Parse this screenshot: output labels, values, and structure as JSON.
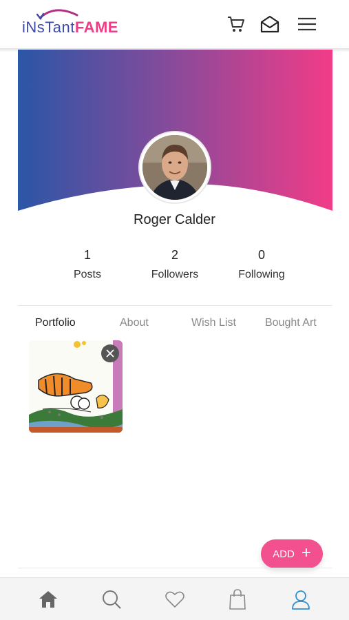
{
  "header": {
    "logo_part1": "iNsTant",
    "logo_part2": "FAME",
    "icons": [
      "cart-icon",
      "mail-open-icon",
      "menu-icon"
    ]
  },
  "colors": {
    "brand_blue": "#2f57a8",
    "brand_pink": "#f23c87",
    "accent_pink": "#f2508e",
    "active_nav": "#2f8fcf"
  },
  "profile": {
    "name": "Roger Calder"
  },
  "stats": [
    {
      "value": "1",
      "label": "Posts"
    },
    {
      "value": "2",
      "label": "Followers"
    },
    {
      "value": "0",
      "label": "Following"
    }
  ],
  "tabs": [
    {
      "label": "Portfolio",
      "active": true
    },
    {
      "label": "About",
      "active": false
    },
    {
      "label": "Wish List",
      "active": false
    },
    {
      "label": "Bought Art",
      "active": false
    }
  ],
  "add_button": {
    "label": "ADD"
  },
  "bottom_nav": [
    {
      "icon": "home-icon",
      "active": false
    },
    {
      "icon": "search-icon",
      "active": false
    },
    {
      "icon": "heart-icon",
      "active": false
    },
    {
      "icon": "shopping-bag-icon",
      "active": false
    },
    {
      "icon": "user-icon",
      "active": true
    }
  ]
}
